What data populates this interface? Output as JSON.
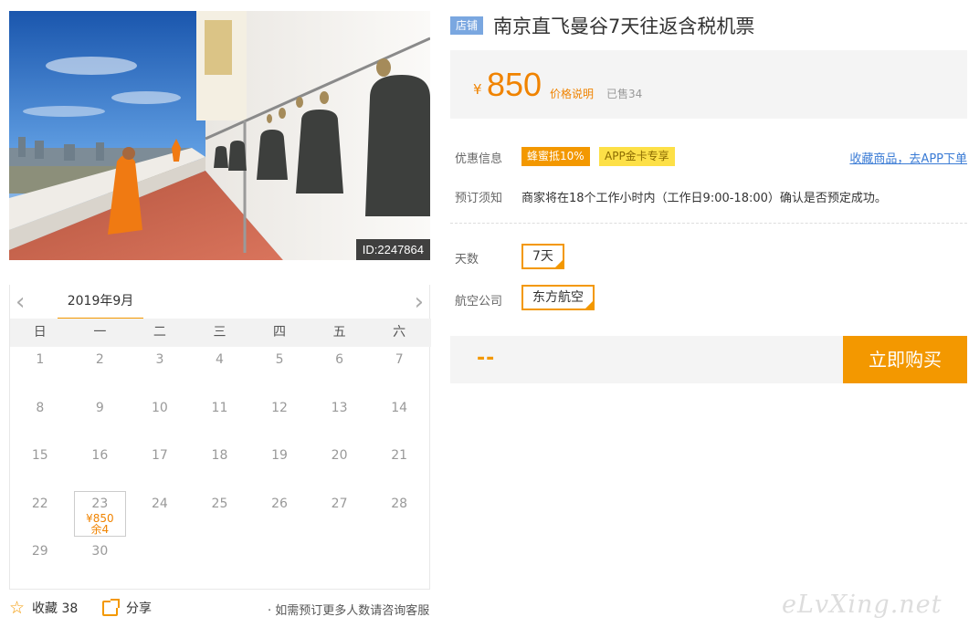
{
  "photo": {
    "id_label": "ID:2247864"
  },
  "calendar": {
    "month_label": "2019年9月",
    "prev_glyph": "‹",
    "next_glyph": "›",
    "weekdays": [
      "日",
      "一",
      "二",
      "三",
      "四",
      "五",
      "六"
    ],
    "weeks": [
      [
        "1",
        "2",
        "3",
        "4",
        "5",
        "6",
        "7"
      ],
      [
        "8",
        "9",
        "10",
        "11",
        "12",
        "13",
        "14"
      ],
      [
        "15",
        "16",
        "17",
        "18",
        "19",
        "20",
        "21"
      ],
      [
        "22",
        "23",
        "24",
        "25",
        "26",
        "27",
        "28"
      ],
      [
        "29",
        "30",
        "",
        "",
        "",
        "",
        ""
      ]
    ],
    "available_day": {
      "day": "23",
      "price": "¥850",
      "remain": "余4"
    }
  },
  "footer": {
    "collect_label": "收藏 38",
    "share_label": "分享",
    "consult_text": "· 如需预订更多人数请咨询客服"
  },
  "product": {
    "shop_tag": "店铺",
    "title": "南京直飞曼谷7天往返含税机票",
    "currency": "¥",
    "price": "850",
    "price_explain": "价格说明",
    "sold": "已售34"
  },
  "info": {
    "promo_label": "优惠信息",
    "promo_tag1": "蜂蜜抵10%",
    "promo_tag2": "APP金卡专享",
    "app_link": "收藏商品，去APP下单",
    "notice_label": "预订须知",
    "notice_text": "商家将在18个工作小时内（工作日9:00-18:00）确认是否预定成功。"
  },
  "options": {
    "days_label": "天数",
    "days_value": "7天",
    "airline_label": "航空公司",
    "airline_value": "东方航空"
  },
  "purchase": {
    "price_placeholder": "--",
    "buy_label": "立即购买"
  },
  "watermark": "eLvXing.net",
  "colors": {
    "accent": "#f39800",
    "price": "#f08300",
    "link": "#3a7bd5",
    "shop_tag": "#7aa7e0"
  }
}
